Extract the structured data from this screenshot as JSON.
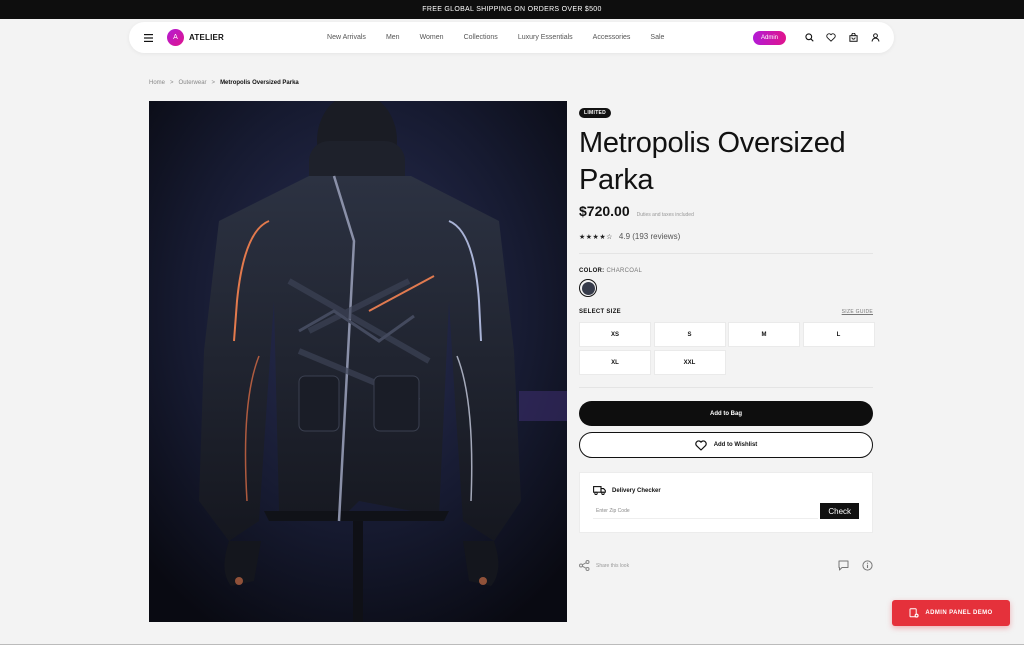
{
  "announcement": "FREE GLOBAL SHIPPING ON ORDERS OVER $500",
  "header": {
    "logo_letter": "A",
    "brand": "ATELIER",
    "links": [
      "New Arrivals",
      "Men",
      "Women",
      "Collections",
      "Luxury Essentials",
      "Accessories",
      "Sale"
    ],
    "admin_label": "Admin",
    "icons": [
      "search-icon",
      "heart-icon",
      "bag-icon",
      "user-icon"
    ]
  },
  "breadcrumb": {
    "items": [
      "Home",
      "Outerwear"
    ],
    "separator": ">",
    "current": "Metropolis Oversized Parka"
  },
  "product": {
    "badge": "LIMITED",
    "title": "Metropolis Oversized Parka",
    "price": "$720.00",
    "price_note": "Duties and taxes included",
    "stars": "★★★★☆",
    "rating_value": 4.5,
    "rating_text": "4.9 (193 reviews)",
    "color_label": "COLOR:",
    "color_value": "CHARCOAL",
    "swatch_color": "#363b4a",
    "size_title": "SELECT SIZE",
    "size_guide": "SIZE GUIDE",
    "sizes": [
      "XS",
      "S",
      "M",
      "L",
      "XL",
      "XXL"
    ],
    "add_to_bag": "Add to Bag",
    "add_to_wishlist": "Add to Wishlist"
  },
  "delivery": {
    "title": "Delivery Checker",
    "zip_placeholder": "Enter Zip Code",
    "check_label": "Check"
  },
  "share": {
    "label": "Share this look"
  },
  "admin_demo": {
    "label": "ADMIN PANEL DEMO"
  },
  "colors": {
    "accent_gradient_start": "#b21bd6",
    "accent_gradient_end": "#e0148c",
    "admin_demo_red": "#e5313b",
    "primary_black": "#0e0e0e"
  }
}
